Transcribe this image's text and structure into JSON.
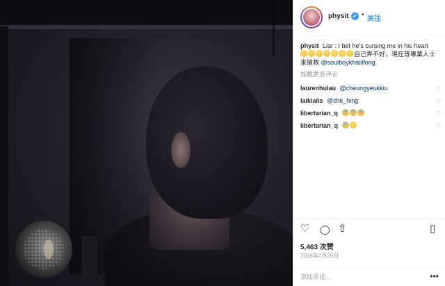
{
  "post": {
    "username": "physit",
    "follow_label": "关注",
    "separator": "•",
    "caption": {
      "username": "physit",
      "text": "Liar : I bet he's cursing me in his heart",
      "text_2": "自己弄不好，現在等專業人士來搶救",
      "mention": "@soulboykhalilfong"
    },
    "load_more": "加載更多评论",
    "comments": [
      {
        "user": "laurenhulau",
        "text": "@cheungyeukkiu"
      },
      {
        "user": "laikialis",
        "text": "@chk_hing"
      },
      {
        "user": "libertarian_q",
        "text": ""
      },
      {
        "user": "libertarian_q",
        "text": ""
      }
    ],
    "likes": "5,463 次赞",
    "date": "2016年2月26日",
    "add_comment_placeholder": "添加评论...",
    "more_label": "•••"
  },
  "icons": {
    "verified": "✔",
    "heart_outline": "♡",
    "comment": "◯",
    "share": "⇧",
    "bookmark": "▯"
  },
  "colors": {
    "link": "#003569",
    "accent": "#3897f0",
    "muted": "#999999"
  }
}
